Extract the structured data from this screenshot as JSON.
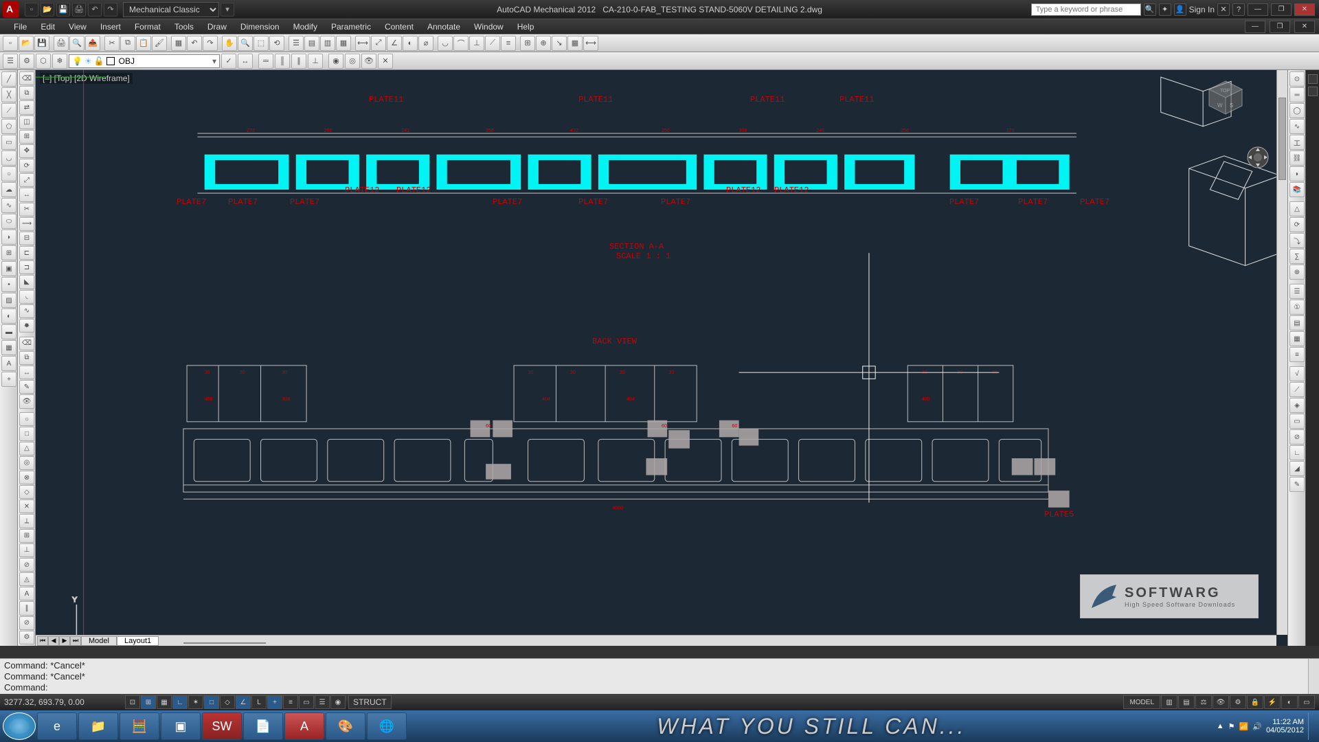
{
  "app": {
    "title_prefix": "AutoCAD Mechanical 2012",
    "doc": "CA-210-0-FAB_TESTING STAND-5060V DETAILING 2.dwg",
    "workspace": "Mechanical Classic",
    "search_placeholder": "Type a keyword or phrase",
    "signin": "Sign In"
  },
  "menu": [
    "File",
    "Edit",
    "View",
    "Insert",
    "Format",
    "Tools",
    "Draw",
    "Dimension",
    "Modify",
    "Parametric",
    "Content",
    "Annotate",
    "Window",
    "Help"
  ],
  "layerbar": {
    "current": "OBJ"
  },
  "viewport": {
    "label": "[–] [Top] [2D Wireframe]"
  },
  "layout": {
    "tabs": [
      "Model",
      "Layout1"
    ],
    "active": "Model"
  },
  "drawing": {
    "section_title": "SECTION A-A",
    "section_scale": "SCALE 1 : 1",
    "backview": "BACK  VIEW",
    "plate5": "PLATE5",
    "plate11": [
      "PLATE11",
      "PLATE11",
      "PLATE11",
      "PLATE11"
    ],
    "plate12": [
      "PLATE12",
      "PLATE12",
      "PLATE12",
      "PLATE12"
    ],
    "plate7": [
      "PLATE7",
      "PLATE7",
      "PLATE7",
      "PLATE7",
      "PLATE7",
      "PLATE7",
      "PLATE7",
      "PLATE7",
      "PLATE7"
    ]
  },
  "cmd": {
    "hist1": "Command: *Cancel*",
    "hist2": "Command: *Cancel*",
    "prompt": "Command:"
  },
  "status": {
    "coords": "3277.32, 693.79, 0.00",
    "layer": "STRUCT",
    "model": "MODEL"
  },
  "taskbar": {
    "text": "WHAT YOU STILL CAN...",
    "time": "11:22 AM",
    "date": "04/05/2012"
  },
  "watermark": {
    "name": "SOFTWARG",
    "tag": "High Speed Software Downloads"
  }
}
